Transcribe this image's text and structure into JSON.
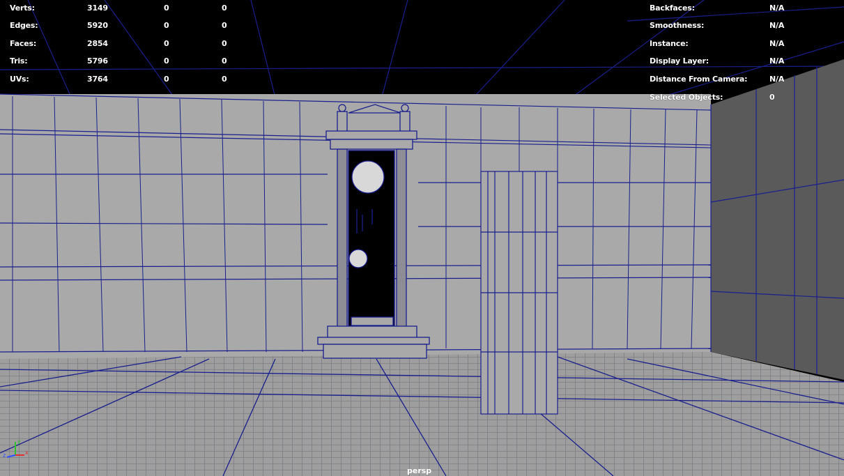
{
  "hud_left": {
    "rows": [
      {
        "label": "Verts:",
        "total": "3149",
        "selected": "0",
        "other": "0"
      },
      {
        "label": "Edges:",
        "total": "5920",
        "selected": "0",
        "other": "0"
      },
      {
        "label": "Faces:",
        "total": "2854",
        "selected": "0",
        "other": "0"
      },
      {
        "label": "Tris:",
        "total": "5796",
        "selected": "0",
        "other": "0"
      },
      {
        "label": "UVs:",
        "total": "3764",
        "selected": "0",
        "other": "0"
      }
    ]
  },
  "hud_right": {
    "rows": [
      {
        "label": "Backfaces:",
        "value": "N/A"
      },
      {
        "label": "Smoothness:",
        "value": "N/A"
      },
      {
        "label": "Instance:",
        "value": "N/A"
      },
      {
        "label": "Display Layer:",
        "value": "N/A"
      },
      {
        "label": "Distance From Camera:",
        "value": "N/A"
      },
      {
        "label": "Selected Objects:",
        "value": "0"
      }
    ]
  },
  "camera": {
    "name": "persp"
  },
  "axis": {
    "x": "x",
    "y": "y",
    "z": "z"
  },
  "colors": {
    "wireframe": "#1a1f8c",
    "wall_face": "#a9a9a9",
    "side_wall": "#5a5a5a",
    "floor": "#9e9e9e",
    "background": "#000000",
    "hud_text": "#ffffff",
    "axis_x": "#e03030",
    "axis_y": "#30c030",
    "axis_z": "#3050ff"
  }
}
